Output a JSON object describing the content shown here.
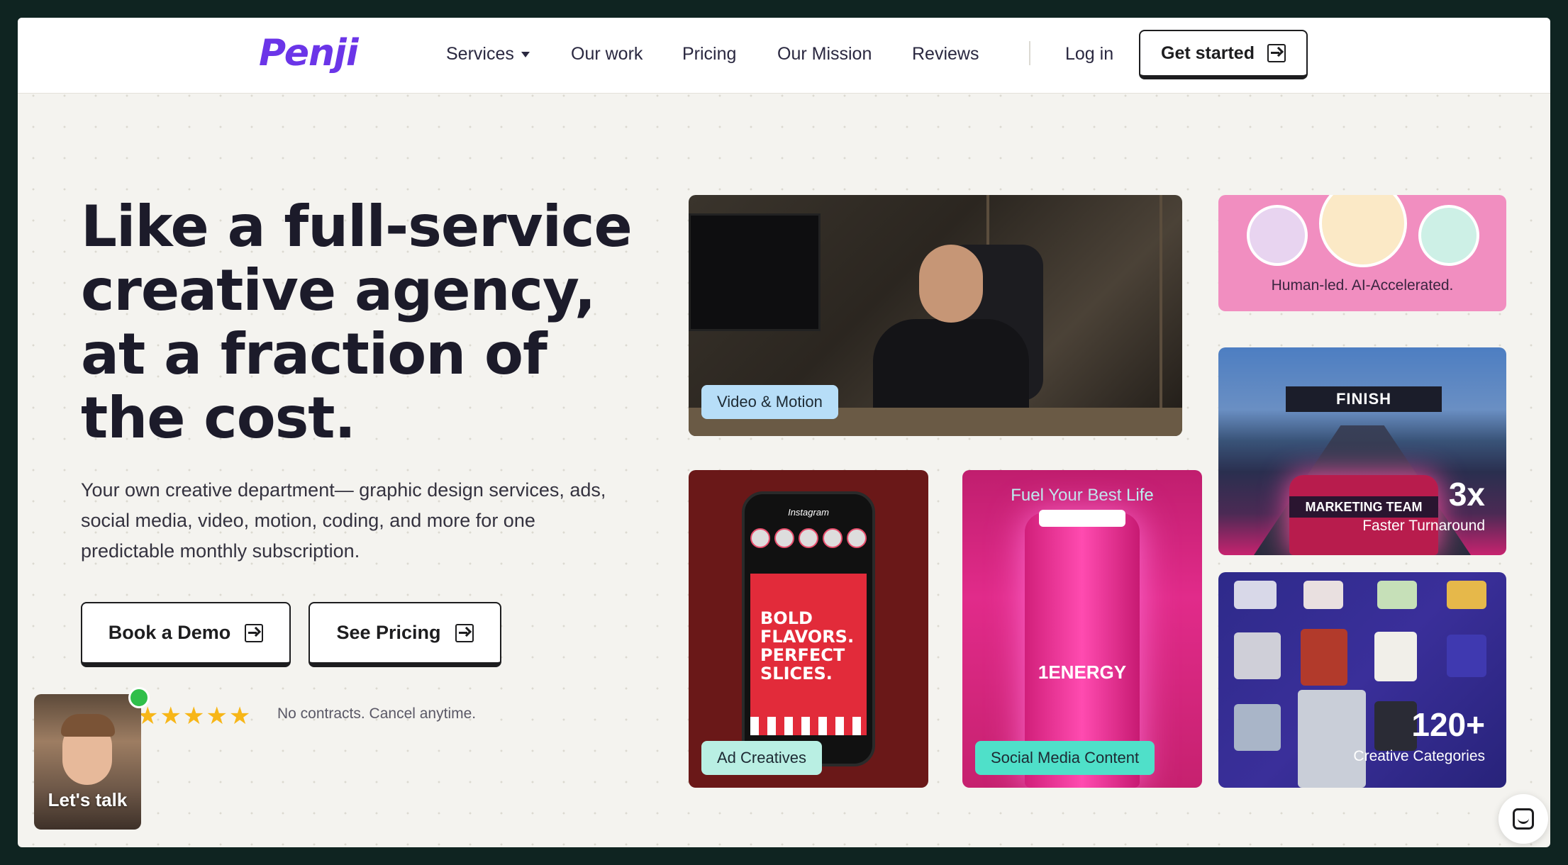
{
  "nav": {
    "logo": "Penji",
    "services": "Services",
    "our_work": "Our work",
    "pricing": "Pricing",
    "our_mission": "Our Mission",
    "reviews": "Reviews",
    "login": "Log in",
    "get_started": "Get started"
  },
  "hero": {
    "title": "Like a full-service creative agency, at a fraction of the cost.",
    "subtitle": "Your own creative department— graphic design services, ads, social media, video, motion, coding, and more for one predictable monthly subscription.",
    "book_demo": "Book a Demo",
    "see_pricing": "See Pricing",
    "stars": "★★★★★",
    "rating_stars": 4.5,
    "no_contracts": "No contracts. Cancel anytime."
  },
  "lets_talk": {
    "label": "Let's talk"
  },
  "cards": {
    "video_tag": "Video & Motion",
    "human_text": "Human-led. AI-Accelerated.",
    "race_finish": "FINISH",
    "race_team": "MARKETING TEAM",
    "race_big": "3x",
    "race_small": "Faster Turnaround",
    "ad_tag": "Ad Creatives",
    "ad_ig": "Instagram",
    "ad_post": "BOLD FLAVORS. PERFECT SLICES.",
    "social_tag": "Social Media Content",
    "social_fuel": "Fuel Your Best Life",
    "social_brand": "1ENERGY",
    "cats_big": "120+",
    "cats_small": "Creative Categories"
  },
  "colors": {
    "brand": "#6b35e8",
    "frame": "#0f2421",
    "video_tag_bg": "#b7def8",
    "ad_tag_bg": "#b9efe3",
    "social_tag_bg": "#4fe0c9",
    "human_card_bg": "#f18ec0",
    "star": "#f7b618",
    "online": "#2fbf4a"
  },
  "icons": {
    "get_started": "arrow-right-box-icon",
    "chat": "chat-bubble-icon",
    "services_caret": "caret-down-icon"
  }
}
